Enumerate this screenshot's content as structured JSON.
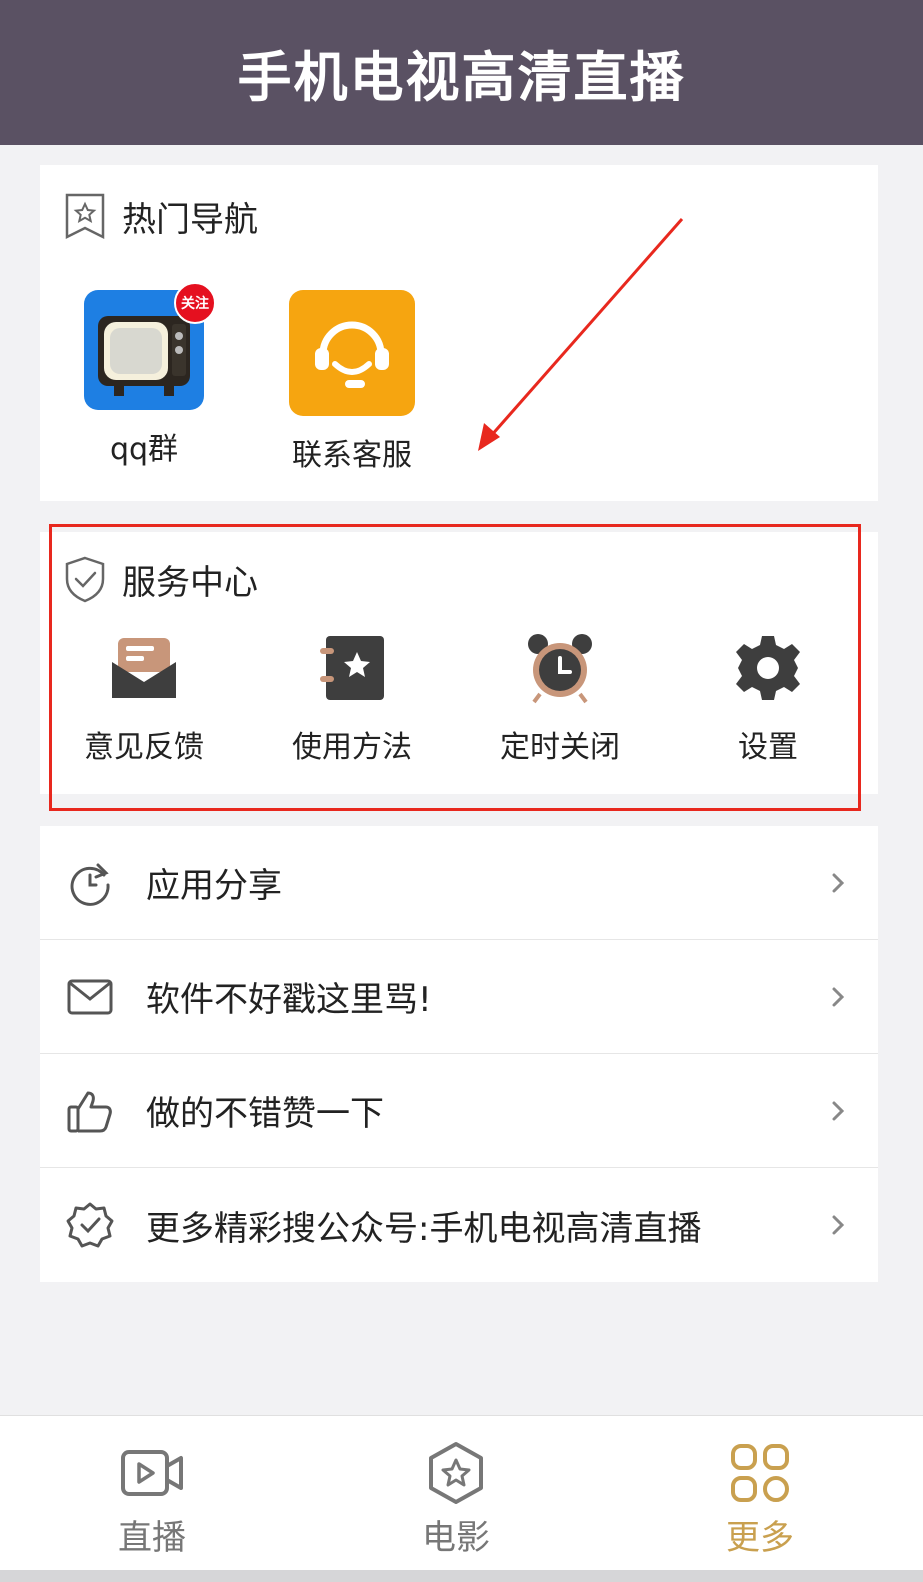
{
  "header": {
    "title": "手机电视高清直播"
  },
  "hot_nav": {
    "title": "热门导航",
    "items": [
      {
        "label": "qq群",
        "badge": "关注",
        "icon": "tv-icon"
      },
      {
        "label": "联系客服",
        "icon": "headset-icon"
      }
    ]
  },
  "service_center": {
    "title": "服务中心",
    "items": [
      {
        "label": "意见反馈",
        "icon": "mailbox-icon"
      },
      {
        "label": "使用方法",
        "icon": "guide-book-icon"
      },
      {
        "label": "定时关闭",
        "icon": "alarm-clock-icon"
      },
      {
        "label": "设置",
        "icon": "gear-icon"
      }
    ]
  },
  "menu": [
    {
      "label": "应用分享",
      "icon": "refresh-share-icon"
    },
    {
      "label": "软件不好戳这里骂!",
      "icon": "envelope-icon"
    },
    {
      "label": "做的不错赞一下",
      "icon": "thumbs-up-icon"
    },
    {
      "label": "更多精彩搜公众号:手机电视高清直播",
      "icon": "verified-badge-icon"
    }
  ],
  "tabbar": {
    "tabs": [
      {
        "label": "直播",
        "icon": "video-icon",
        "active": false
      },
      {
        "label": "电影",
        "icon": "hexagon-star-icon",
        "active": false
      },
      {
        "label": "更多",
        "icon": "grid-more-icon",
        "active": true
      }
    ]
  },
  "colors": {
    "header_bg": "#5a5163",
    "accent": "#c9a04f",
    "highlight": "#e8281e",
    "headset_bg": "#f6a510",
    "tv_bg": "#1e7fe3"
  }
}
